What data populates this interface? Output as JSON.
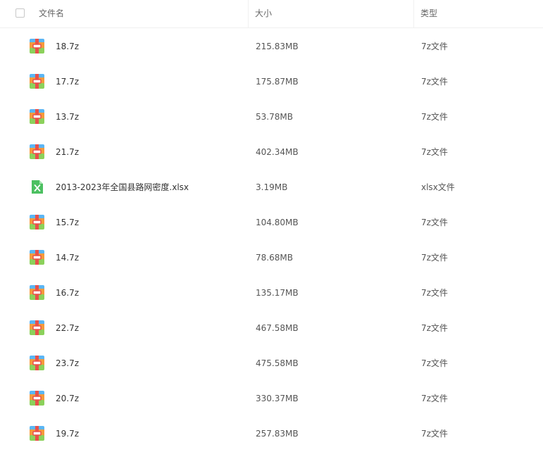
{
  "header": {
    "name_label": "文件名",
    "size_label": "大小",
    "type_label": "类型"
  },
  "files": [
    {
      "name": "18.7z",
      "size": "215.83MB",
      "type": "7z文件",
      "icon": "archive-icon"
    },
    {
      "name": "17.7z",
      "size": "175.87MB",
      "type": "7z文件",
      "icon": "archive-icon"
    },
    {
      "name": "13.7z",
      "size": "53.78MB",
      "type": "7z文件",
      "icon": "archive-icon"
    },
    {
      "name": "21.7z",
      "size": "402.34MB",
      "type": "7z文件",
      "icon": "archive-icon"
    },
    {
      "name": "2013-2023年全国县路网密度.xlsx",
      "size": "3.19MB",
      "type": "xlsx文件",
      "icon": "excel-icon"
    },
    {
      "name": "15.7z",
      "size": "104.80MB",
      "type": "7z文件",
      "icon": "archive-icon"
    },
    {
      "name": "14.7z",
      "size": "78.68MB",
      "type": "7z文件",
      "icon": "archive-icon"
    },
    {
      "name": "16.7z",
      "size": "135.17MB",
      "type": "7z文件",
      "icon": "archive-icon"
    },
    {
      "name": "22.7z",
      "size": "467.58MB",
      "type": "7z文件",
      "icon": "archive-icon"
    },
    {
      "name": "23.7z",
      "size": "475.58MB",
      "type": "7z文件",
      "icon": "archive-icon"
    },
    {
      "name": "20.7z",
      "size": "330.37MB",
      "type": "7z文件",
      "icon": "archive-icon"
    },
    {
      "name": "19.7z",
      "size": "257.83MB",
      "type": "7z文件",
      "icon": "archive-icon"
    }
  ],
  "colors": {
    "archive_top": "#5bb6f5",
    "archive_middle": "#f59a3c",
    "archive_bottom": "#8bd15b",
    "archive_band": "#e8504a",
    "excel_green": "#4cc061"
  }
}
